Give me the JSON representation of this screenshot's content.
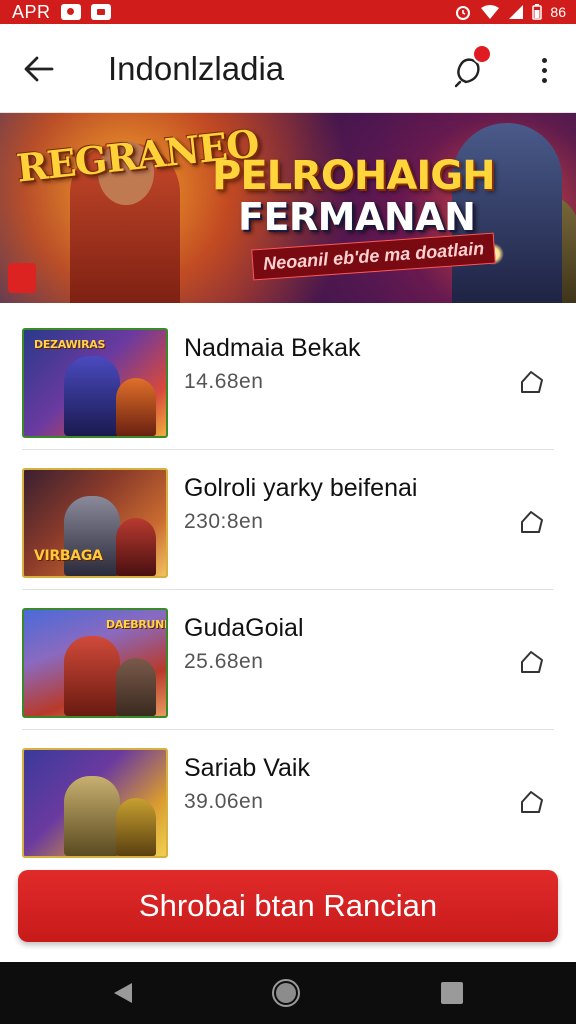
{
  "status_bar": {
    "time": "APR",
    "battery": "86",
    "background": "#d11c1c"
  },
  "header": {
    "title": "Indonlzladia"
  },
  "banner": {
    "left_title": "REGRANEO",
    "title_line1": "PELROHAIGH",
    "title_line2": "FERMANAN",
    "strip_text": "Neoanil eb'de ma doatlain"
  },
  "games": [
    {
      "title": "Nadmaia Bekak",
      "subtitle": "14.68en",
      "thumb_label": "DEZAWIRAS",
      "thumb_colors": [
        "#2a3a8a",
        "#d84a3a",
        "#f0b040"
      ]
    },
    {
      "title": "Golroli yarky beifenai",
      "subtitle": "230:8en",
      "thumb_label": "VIRBAGA",
      "thumb_colors": [
        "#3a2030",
        "#c86a30",
        "#f3c060"
      ]
    },
    {
      "title": "GudaGoial",
      "subtitle": "25.68en",
      "thumb_label": "DAEBRUNI",
      "thumb_colors": [
        "#4a4aa8",
        "#b83a2a",
        "#e89a60"
      ]
    },
    {
      "title": "Sariab Vaik",
      "subtitle": "39.06en",
      "thumb_label": "",
      "thumb_colors": [
        "#3a3a9a",
        "#d89a30",
        "#f0d050"
      ]
    }
  ],
  "cta": {
    "label": "Shrobai btan Rancian",
    "color": "#d42020"
  }
}
